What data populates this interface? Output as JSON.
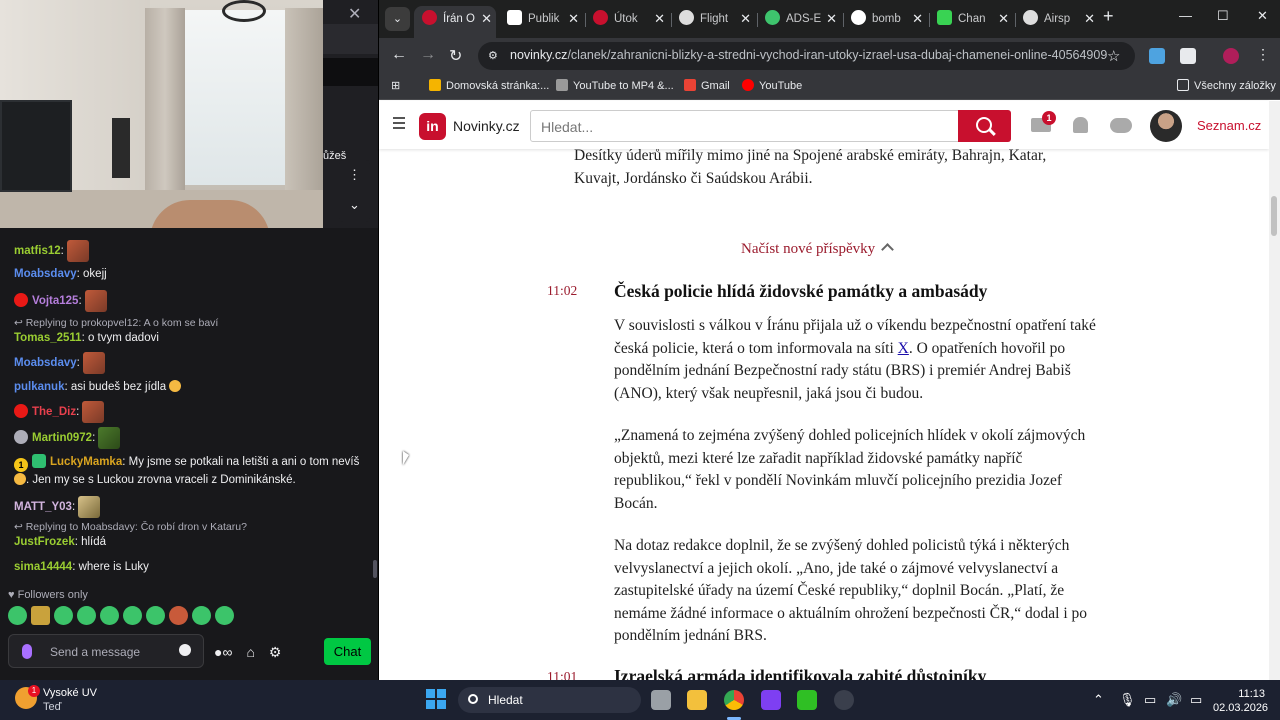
{
  "twitch": {
    "peek_text": "ůžeš",
    "messages": [
      {
        "user": "matfis12",
        "color": "#9acd32",
        "text": ""
      },
      {
        "user": "Moabsdavy",
        "color": "#5b8def",
        "text": "okejj"
      },
      {
        "user": "Vojta125",
        "color": "#b57edc",
        "text": ""
      },
      {
        "reply": "Replying to prokopvel12: A o kom se baví"
      },
      {
        "user": "Tomas_2511",
        "color": "#9acd32",
        "text": "o tvym dadovi"
      },
      {
        "user": "Moabsdavy",
        "color": "#5b8def",
        "text": ""
      },
      {
        "user": "pulkanuk",
        "color": "#5b8def",
        "text": "asi budeš bez jídla"
      },
      {
        "user": "The_Diz",
        "color": "#e8404d",
        "text": ""
      },
      {
        "user": "Martin0972",
        "color": "#9acd32",
        "text": ""
      },
      {
        "user": "LuckyMamka",
        "color": "#daa520",
        "text": "My jsme se potkali na letišti a ani o tom nevíš",
        "text2": ". Jen my se s Luckou zrovna vraceli z Dominikánské."
      },
      {
        "user": "MATT_Y03",
        "color": "#d2b4de",
        "text": ""
      },
      {
        "reply": "Replying to Moabsdavy: Čo robí dron v Kataru?"
      },
      {
        "user": "JustFrozek",
        "color": "#9acd32",
        "text": "hlídá"
      },
      {
        "user": "sima14444",
        "color": "#9acd32",
        "text": "where is Luky"
      }
    ],
    "followers_only": "Followers only",
    "input_placeholder": "Send a message",
    "chat_button": "Chat",
    "badge_number": "1"
  },
  "browser": {
    "tabs": [
      {
        "label": "Írán O",
        "color": "#c8102e",
        "active": true
      },
      {
        "label": "Publik",
        "color": "#ffffff"
      },
      {
        "label": "Útok",
        "color": "#c8102e"
      },
      {
        "label": "Flight",
        "color": "#dddddd"
      },
      {
        "label": "ADS-E",
        "color": "#3ec46d"
      },
      {
        "label": "bomb",
        "color": "#ffffff"
      },
      {
        "label": "Chan",
        "color": "#39d353"
      },
      {
        "label": "Airsp",
        "color": "#dddddd"
      }
    ],
    "url_domain": "novinky.cz",
    "url_path": "/clanek/zahranicni-blizky-a-stredni-vychod-iran-utoky-izrael-usa-dubaj-chamenei-online-40564909",
    "bookmarks": [
      {
        "label": "Domovská stránka:...",
        "color": "#f5b400"
      },
      {
        "label": "YouTube to MP4 &...",
        "color": "#9a9a9a"
      },
      {
        "label": "Gmail",
        "color": "#ea4335"
      },
      {
        "label": "YouTube",
        "color": "#ff0000"
      }
    ],
    "all_bookmarks": "Všechny záložky"
  },
  "site": {
    "logo_letter": "in",
    "logo_text": "Novinky.cz",
    "search_placeholder": "Hledat...",
    "mail_count": "1",
    "seznam": "Seznam.cz"
  },
  "article": {
    "intro": "Desítky úderů mířily mimo jiné na Spojené arabské emiráty, Bahrajn, Katar, Kuvajt, Jordánsko či Saúdskou Arábii.",
    "load_more": "Načíst nové příspěvky",
    "post1": {
      "time": "11:02",
      "title": "Česká policie hlídá židovské památky a ambasády",
      "p1a": "V souvislosti s válkou v Íránu přijala už o víkendu bezpečnostní opatření také česká policie, která o tom informovala na síti ",
      "p1link": "X",
      "p1b": ". O opatřeních hovořil po pondělním jednání Bezpečnostní rady státu (BRS) i premiér Andrej Babiš (ANO), který však neupřesnil, jaká jsou či budou.",
      "p2": "„Znamená to zejména zvýšený dohled policejních hlídek v okolí zájmových objektů, mezi které lze zařadit například židovské památky napříč republikou,“ řekl v pondělí Novinkám mluvčí policejního prezidia Jozef Bocán.",
      "p3": "Na dotaz redakce doplnil, že se zvýšený dohled policistů týká i některých velvyslanectví a jejich okolí. „Ano, jde také o zájmové velvyslanectví a zastupitelské úřady na území České republiky,“ doplnil Bocán. „Platí, že nemáme žádné informace o aktuálním ohrožení bezpečnosti ČR,“ dodal i po pondělním jednání BRS."
    },
    "post2": {
      "time": "11:01",
      "title": "Izraelská armáda identifikovala zabité důstojníky"
    }
  },
  "taskbar": {
    "weather_title": "Vysoké UV",
    "weather_sub": "Teď",
    "weather_badge": "1",
    "search": "Hledat",
    "time": "11:13",
    "date": "02.03.2026"
  }
}
